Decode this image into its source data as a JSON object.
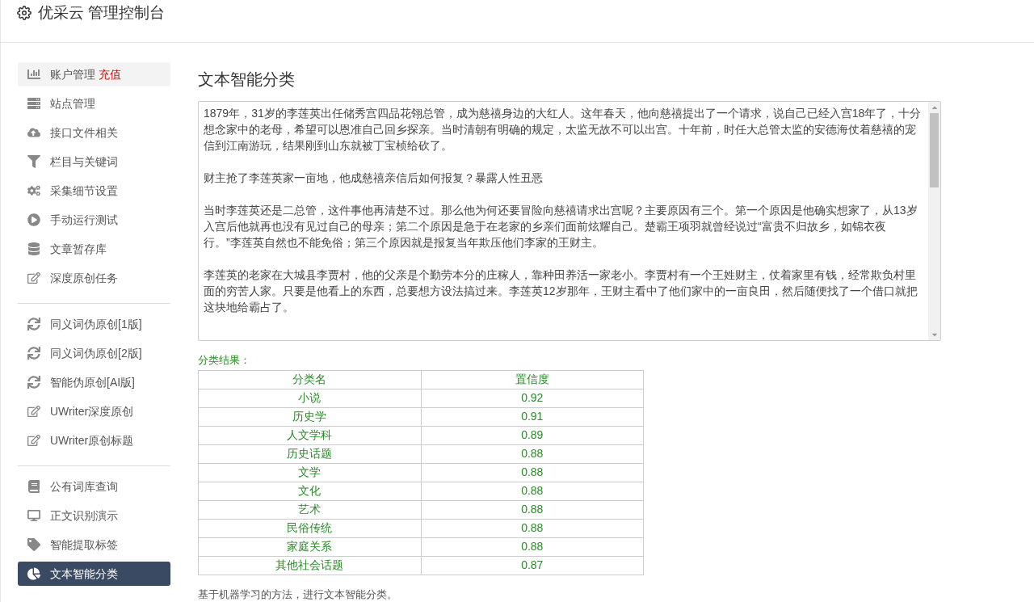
{
  "header": {
    "title": "优采云 管理控制台"
  },
  "sidebar": {
    "groups": [
      [
        {
          "label": "账户管理",
          "badge": "充值",
          "selected": false,
          "hovered": true
        },
        {
          "label": "站点管理",
          "selected": false
        },
        {
          "label": "接口文件相关",
          "selected": false
        },
        {
          "label": "栏目与关键词",
          "selected": false
        },
        {
          "label": "采集细节设置",
          "selected": false
        },
        {
          "label": "手动运行测试",
          "selected": false
        },
        {
          "label": "文章暂存库",
          "selected": false
        },
        {
          "label": "深度原创任务",
          "selected": false
        }
      ],
      [
        {
          "label": "同义词伪原创[1版]",
          "selected": false
        },
        {
          "label": "同义词伪原创[2版]",
          "selected": false
        },
        {
          "label": "智能伪原创[AI版]",
          "selected": false
        },
        {
          "label": "UWriter深度原创",
          "selected": false
        },
        {
          "label": "UWriter原创标题",
          "selected": false
        }
      ],
      [
        {
          "label": "公有词库查询",
          "selected": false
        },
        {
          "label": "正文识别演示",
          "selected": false
        },
        {
          "label": "智能提取标签",
          "selected": false
        },
        {
          "label": "文本智能分类",
          "selected": true
        }
      ]
    ]
  },
  "main": {
    "title": "文本智能分类",
    "text_area": {
      "paragraphs": [
        "1879年，31岁的李莲英出任储秀宫四品花翎总管，成为慈禧身边的大红人。这年春天，他向慈禧提出了一个请求，说自己已经入宫18年了，十分想念家中的老母，希望可以恩准自己回乡探亲。当时清朝有明确的规定，太监无故不可以出宫。十年前，时任大总管太监的安德海仗着慈禧的宠信到江南游玩，结果刚到山东就被丁宝桢给砍了。",
        "财主抢了李莲英家一亩地，他成慈禧亲信后如何报复？暴露人性丑恶",
        "当时李莲英还是二总管，这件事他再清楚不过。那么他为何还要冒险向慈禧请求出宫呢？主要原因有三个。第一个原因是他确实想家了，从13岁入宫后他就再也没有见过自己的母亲；第二个原因是急于在老家的乡亲们面前炫耀自己。楚霸王项羽就曾经说过“富贵不归故乡，如锦衣夜行。”李莲英自然也不能免俗；第三个原因就是报复当年欺压他们李家的王财主。",
        "李莲英的老家在大城县李贾村，他的父亲是个勤劳本分的庄稼人，靠种田养活一家老小。李贾村有一个王姓财主，仗着家里有钱，经常欺负村里面的穷苦人家。只要是他看上的东西，总要想方设法搞过来。李莲英12岁那年，王财主看中了他们家中的一亩良田，然后随便找了一个借口就把这块地给霸占了。"
      ]
    },
    "result_label": "分类结果：",
    "table": {
      "columns": [
        "分类名",
        "置信度"
      ],
      "rows": [
        [
          "小说",
          "0.92"
        ],
        [
          "历史学",
          "0.91"
        ],
        [
          "人文学科",
          "0.89"
        ],
        [
          "历史话题",
          "0.88"
        ],
        [
          "文学",
          "0.88"
        ],
        [
          "文化",
          "0.88"
        ],
        [
          "艺术",
          "0.88"
        ],
        [
          "民俗传统",
          "0.88"
        ],
        [
          "家庭关系",
          "0.88"
        ],
        [
          "其他社会话题",
          "0.87"
        ]
      ]
    },
    "footnote": "基于机器学习的方法，进行文本智能分类。"
  }
}
